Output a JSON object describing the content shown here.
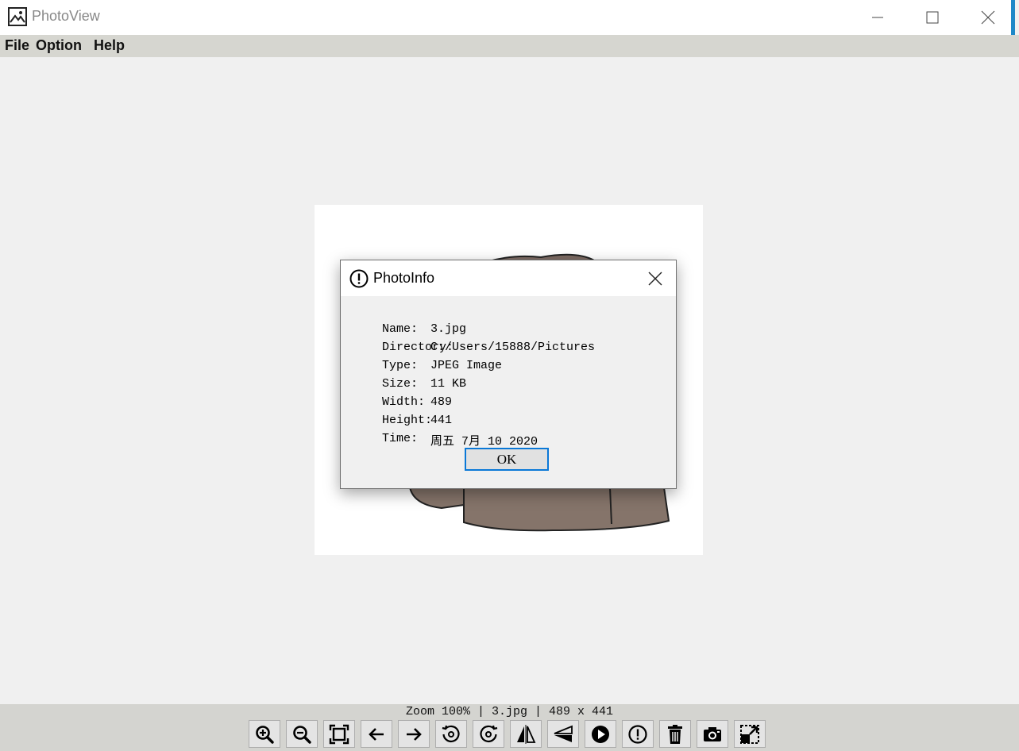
{
  "window": {
    "title": "PhotoView"
  },
  "menu": {
    "file": "File",
    "option": "Option",
    "help": "Help"
  },
  "dialog": {
    "title": "PhotoInfo",
    "rows": [
      {
        "label": "Name:",
        "value": "3.jpg"
      },
      {
        "label": "Directory:",
        "value": "C:/Users/15888/Pictures"
      },
      {
        "label": "Type:",
        "value": "JPEG Image"
      },
      {
        "label": "Size:",
        "value": "11 KB"
      },
      {
        "label": "Width:",
        "value": "489"
      },
      {
        "label": "Height:",
        "value": "441"
      },
      {
        "label": "Time:",
        "value": "周五 7月 10 2020"
      }
    ],
    "ok_label": "OK"
  },
  "status": {
    "text": "Zoom 100% | 3.jpg | 489 x 441"
  },
  "toolbar": {
    "icons": [
      "zoom-in-icon",
      "zoom-out-icon",
      "fit-to-window-icon",
      "previous-arrow-icon",
      "next-arrow-icon",
      "rotate-left-icon",
      "rotate-right-icon",
      "flip-horizontal-icon",
      "flip-vertical-icon",
      "slideshow-play-icon",
      "info-icon",
      "delete-trash-icon",
      "screenshot-camera-icon",
      "fullscreen-icon"
    ]
  }
}
